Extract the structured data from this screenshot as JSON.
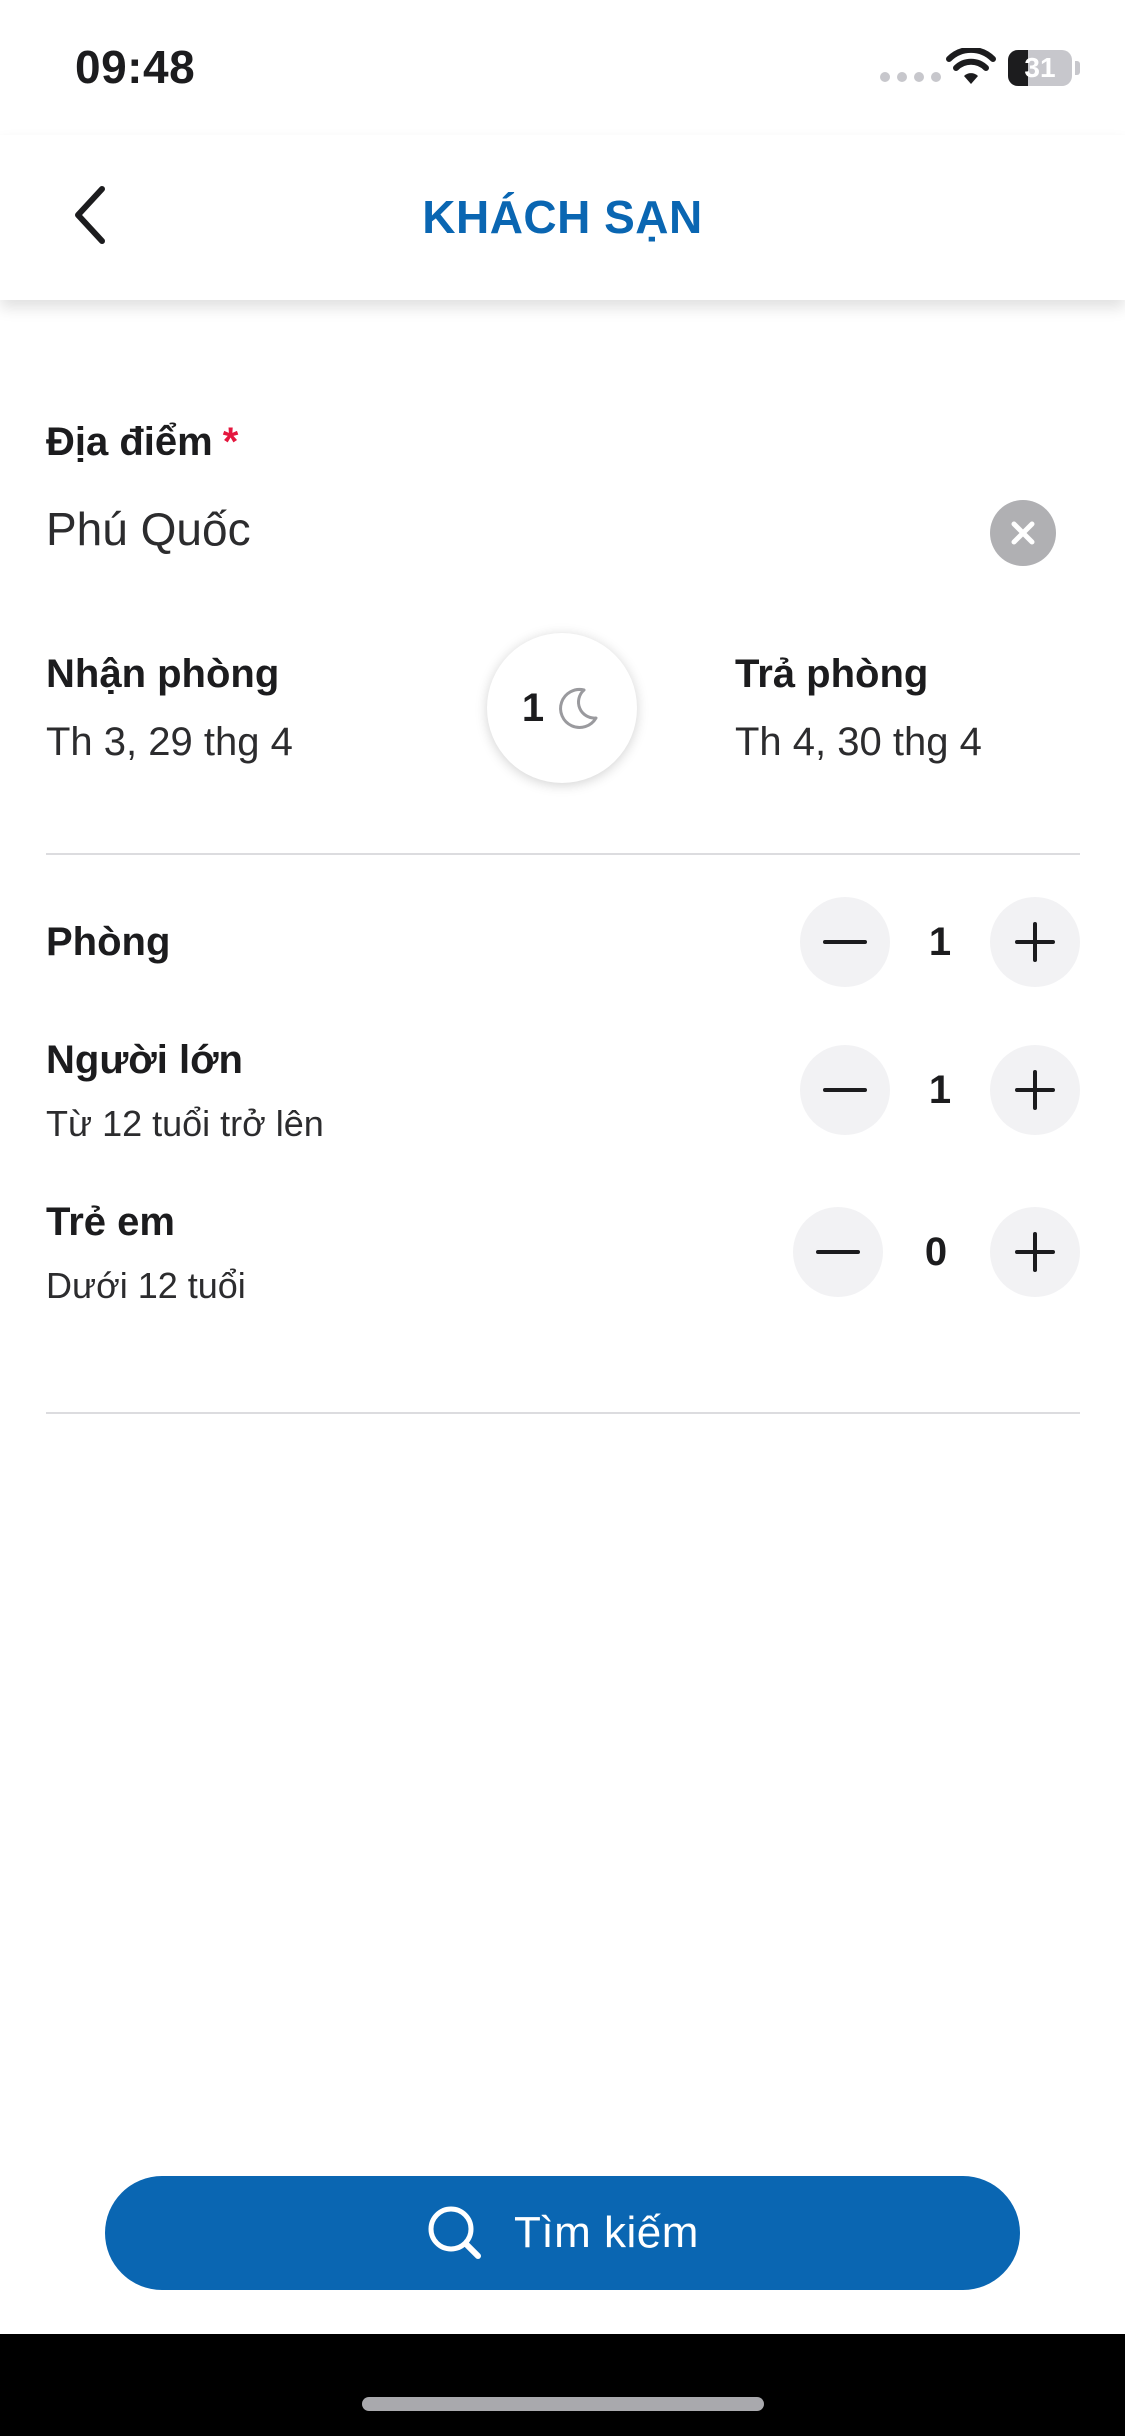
{
  "status_bar": {
    "time": "09:48",
    "battery": "31",
    "battery_level": 0.31
  },
  "header": {
    "title": "KHÁCH SẠN",
    "back_icon": "chevron-left-icon"
  },
  "location": {
    "label": "Địa điểm",
    "required_mark": "*",
    "value": "Phú Quốc",
    "clear_icon": "close-icon"
  },
  "dates": {
    "checkin_label": "Nhận phòng",
    "checkin_value": "Th 3, 29 thg 4",
    "nights": "1",
    "nights_icon": "moon-icon",
    "checkout_label": "Trả phòng",
    "checkout_value": "Th 4, 30 thg 4"
  },
  "occupancy": {
    "rooms": {
      "label": "Phòng",
      "value": "1"
    },
    "adults": {
      "label": "Người lớn",
      "sublabel": "Từ 12 tuổi trở lên",
      "value": "1"
    },
    "children": {
      "label": "Trẻ em",
      "sublabel": "Dưới 12 tuổi",
      "value": "0"
    }
  },
  "search": {
    "label": "Tìm kiếm",
    "icon": "search-icon"
  },
  "colors": {
    "accent": "#0a66b2",
    "required": "#e4173e",
    "stepper_bg": "#f2f2f4"
  }
}
